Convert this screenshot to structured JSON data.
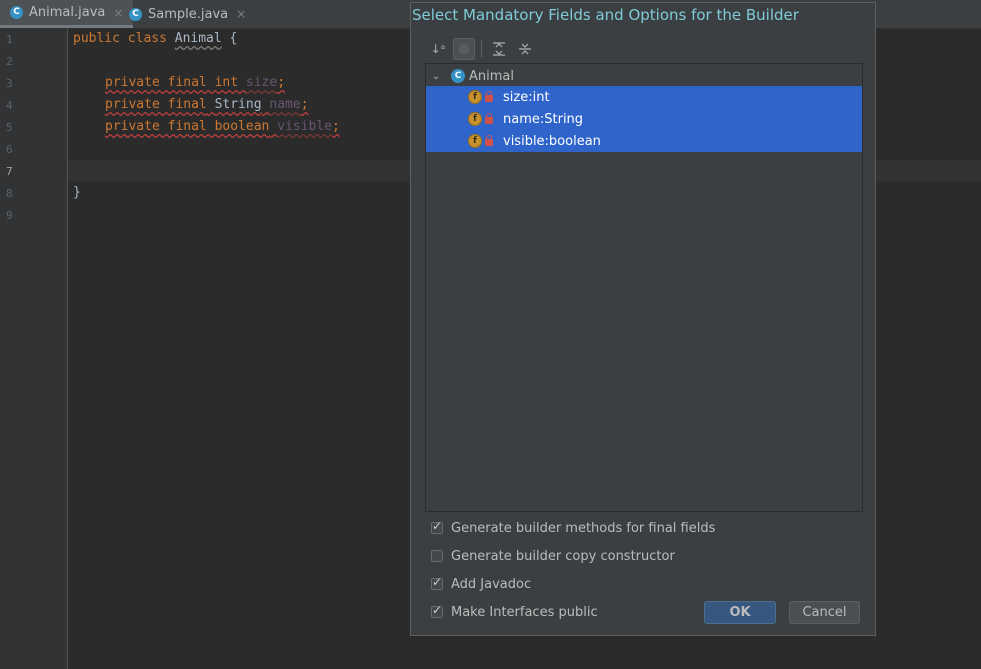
{
  "tabs": [
    {
      "label": "Animal.java",
      "icon": "class-icon",
      "active": true
    },
    {
      "label": "Sample.java",
      "icon": "class-icon",
      "active": false
    }
  ],
  "tab_icon_letter": "C",
  "tab_close_glyph": "×",
  "line_numbers": [
    "1",
    "2",
    "3",
    "4",
    "5",
    "6",
    "7",
    "8",
    "9"
  ],
  "code": {
    "line1": {
      "kw": "public class",
      "name": "Animal",
      "brace": "{"
    },
    "line3": {
      "kw": "private final int",
      "name": "size",
      "semi": ";"
    },
    "line4": {
      "kw": "private final",
      "type": "String",
      "name": "name",
      "semi": ";"
    },
    "line5": {
      "kw": "private final boolean",
      "name": "visible",
      "semi": ";"
    },
    "line8": {
      "brace": "}"
    }
  },
  "dialog": {
    "title": "Select Mandatory Fields and Options for the Builder",
    "toolbar": [
      {
        "name": "sort-alpha-icon",
        "glyph": "↓ᵃ"
      },
      {
        "name": "show-classes-icon",
        "glyph": "●"
      },
      {
        "name": "expand-all-icon",
        "glyph": "⇕"
      },
      {
        "name": "collapse-all-icon",
        "glyph": "÷"
      }
    ],
    "tree": {
      "root": "Animal",
      "root_icon_letter": "C",
      "expand_glyph": "⌄",
      "field_icon_letter": "f",
      "fields": [
        "size:int",
        "name:String",
        "visible:boolean"
      ]
    },
    "options": [
      {
        "label": "Generate builder methods for final fields",
        "checked": true
      },
      {
        "label": "Generate builder copy constructor",
        "checked": false
      },
      {
        "label": "Add Javadoc",
        "checked": true
      },
      {
        "label": "Make Interfaces public",
        "checked": true
      }
    ],
    "ok_label": "OK",
    "cancel_label": "Cancel"
  },
  "colors": {
    "editor_bg": "#2b2b2b",
    "keyword": "#cc7832",
    "title_color": "#7ecbd9",
    "selection": "#2f65ca"
  }
}
